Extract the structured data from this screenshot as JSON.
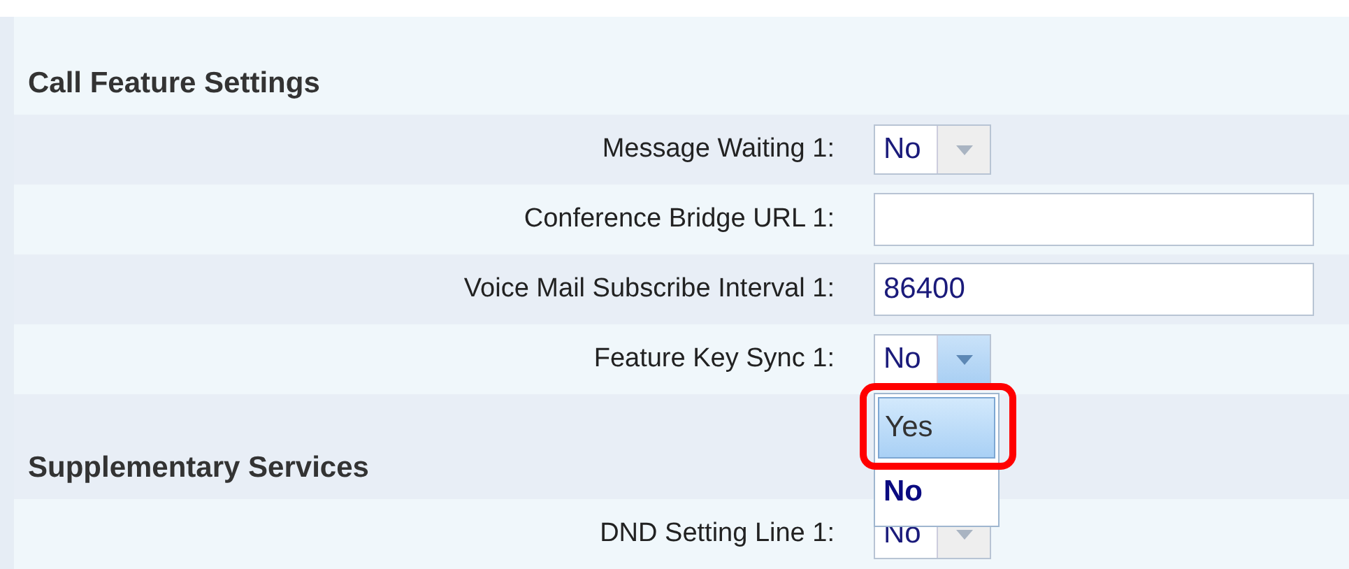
{
  "sections": [
    {
      "title": "Call Feature Settings",
      "rows": [
        {
          "label": "Message Waiting 1:",
          "kind": "select",
          "value": "No",
          "open": false
        },
        {
          "label": "Conference Bridge URL 1:",
          "kind": "text"
        },
        {
          "label": "Voice Mail Subscribe Interval 1:",
          "kind": "text",
          "value": "86400"
        },
        {
          "label": "Feature Key Sync 1:",
          "kind": "select",
          "value": "No",
          "open": true,
          "options": [
            {
              "label": "Yes",
              "selected": false,
              "highlighted": true
            },
            {
              "label": "No",
              "selected": true,
              "highlighted": false
            }
          ]
        }
      ]
    },
    {
      "title": "Supplementary Services",
      "rows": [
        {
          "label": "DND Setting Line 1:",
          "kind": "select",
          "value": "No",
          "open": false
        }
      ]
    }
  ]
}
